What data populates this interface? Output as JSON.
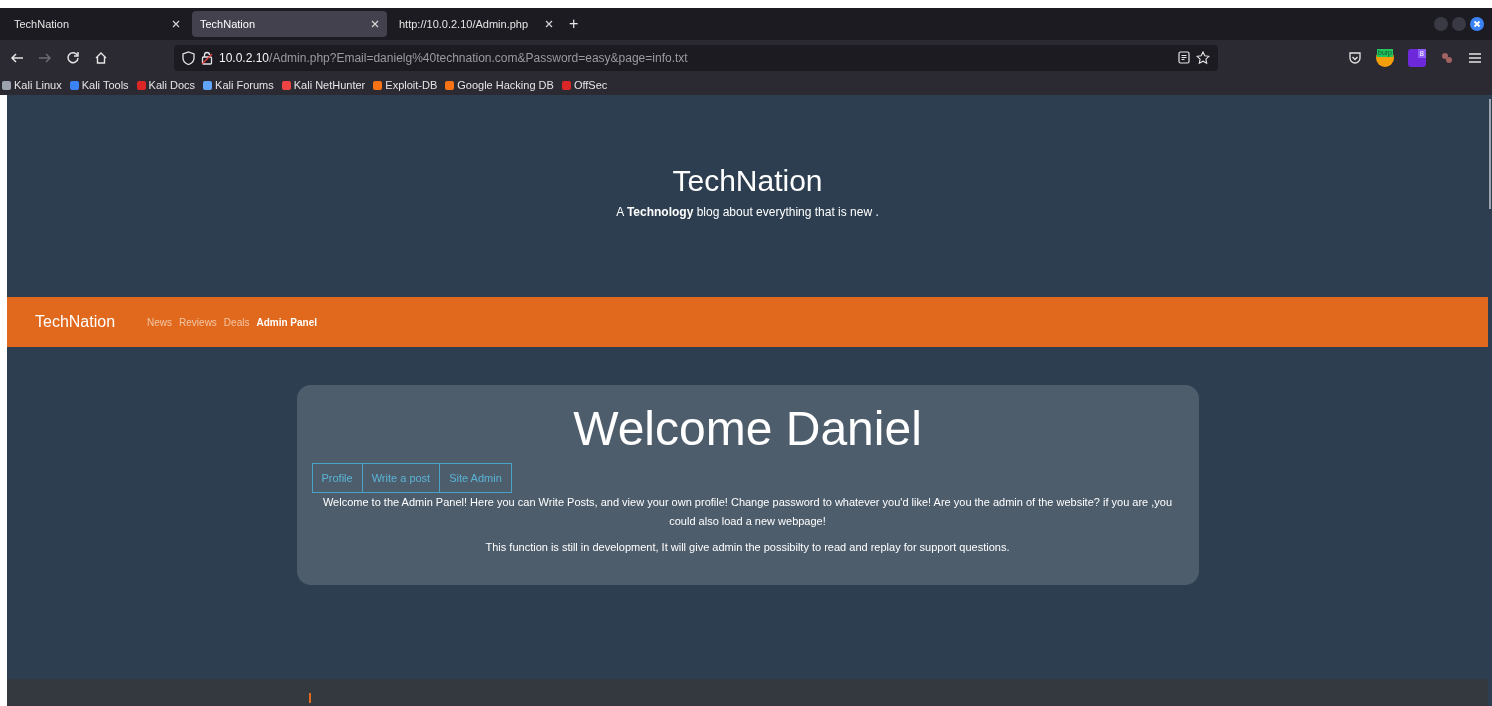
{
  "tabs": [
    {
      "label": "TechNation",
      "selected": false
    },
    {
      "label": "TechNation",
      "selected": true
    },
    {
      "label": "http://10.0.2.10/Admin.php",
      "selected": false
    }
  ],
  "new_tab": "+",
  "address_bar": {
    "host": "10.0.2.10",
    "path": "/Admin.php?Email=danielg%40technation.com&Password=easy&page=info.txt"
  },
  "extensions": [
    {
      "label": "burp"
    },
    {
      "label": "8"
    }
  ],
  "bookmarks": [
    {
      "label": "Kali Linux",
      "color": "#9ca3af"
    },
    {
      "label": "Kali Tools",
      "color": "#3b82f6"
    },
    {
      "label": "Kali Docs",
      "color": "#dc2626"
    },
    {
      "label": "Kali Forums",
      "color": "#60a5fa"
    },
    {
      "label": "Kali NetHunter",
      "color": "#ef4444"
    },
    {
      "label": "Exploit-DB",
      "color": "#f97316"
    },
    {
      "label": "Google Hacking DB",
      "color": "#f97316"
    },
    {
      "label": "OffSec",
      "color": "#dc2626"
    }
  ],
  "site": {
    "title": "TechNation",
    "tagline": "A **Technology** blog about everything that is new ."
  },
  "nav": {
    "brand": "TechNation",
    "items": [
      {
        "label": "News",
        "selected": false
      },
      {
        "label": "Reviews",
        "selected": false
      },
      {
        "label": "Deals",
        "selected": false
      },
      {
        "label": "Admin Panel",
        "selected": true
      }
    ]
  },
  "panel": {
    "heading": "Welcome Daniel",
    "buttons": [
      "Profile",
      "Write a post",
      "Site Admin"
    ],
    "text": "Welcome to the Admin Panel! Here you can Write Posts, and view your own profile! Change password to whatever you'd like! Are you the admin of the website? if you are ,you could also load a new webpage!",
    "note": "This function is still in development, It will give admin the possibilty to read and replay for support questions."
  }
}
